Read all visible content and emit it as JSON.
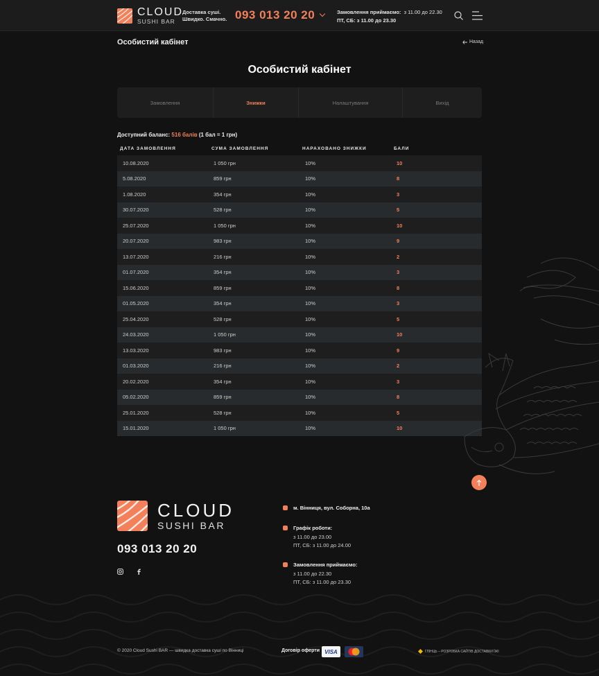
{
  "header": {
    "logo_big": "CLOUD",
    "logo_small": "SUSHI BAR",
    "slogan_line1": "Доставка суші.",
    "slogan_line2": "Швидко. Смачно.",
    "phone": "093 013 20 20",
    "hours_label": "Замовлення приймаємо:",
    "hours_weekday": "з 11.00 до 22.30",
    "hours_weekend": "ПТ, СБ: з 11.00 до 23.30"
  },
  "page": {
    "breadcrumb_title": "Особистий кабінет",
    "back_label": "Назад",
    "title": "Особистий кабінет"
  },
  "tabs": [
    {
      "label": "Замовлення",
      "active": false
    },
    {
      "label": "Знижки",
      "active": true
    },
    {
      "label": "Налаштування",
      "active": false
    },
    {
      "label": "Вихід",
      "active": false
    }
  ],
  "balance": {
    "label": "Доступний баланс:",
    "value": "516 балів",
    "note": "(1 бал = 1 грн)"
  },
  "table": {
    "headers": [
      "ДАТА ЗАМОВЛЕННЯ",
      "СУМА ЗАМОВЛЕННЯ",
      "НАРАХОВАНО ЗНИЖКИ",
      "БАЛИ"
    ],
    "rows": [
      [
        "10.08.2020",
        "1 050 грн",
        "10%",
        "10"
      ],
      [
        "5.08.2020",
        "859 грн",
        "10%",
        "8"
      ],
      [
        "1.08.2020",
        "354 грн",
        "10%",
        "3"
      ],
      [
        "30.07.2020",
        "528 грн",
        "10%",
        "5"
      ],
      [
        "25.07.2020",
        "1 050 грн",
        "10%",
        "10"
      ],
      [
        "20.07.2020",
        "983 грн",
        "10%",
        "9"
      ],
      [
        "13.07.2020",
        "216 грн",
        "10%",
        "2"
      ],
      [
        "01.07.2020",
        "354 грн",
        "10%",
        "3"
      ],
      [
        "15.06.2020",
        "859 грн",
        "10%",
        "8"
      ],
      [
        "01.05.2020",
        "354 грн",
        "10%",
        "3"
      ],
      [
        "25.04.2020",
        "528 грн",
        "10%",
        "5"
      ],
      [
        "24.03.2020",
        "1 050 грн",
        "10%",
        "10"
      ],
      [
        "13.03.2020",
        "983 грн",
        "10%",
        "9"
      ],
      [
        "01.03.2020",
        "216 грн",
        "10%",
        "2"
      ],
      [
        "20.02.2020",
        "354 грн",
        "10%",
        "3"
      ],
      [
        "05.02.2020",
        "859 грн",
        "10%",
        "8"
      ],
      [
        "25.01.2020",
        "528 грн",
        "10%",
        "5"
      ],
      [
        "15.01.2020",
        "1 050 грн",
        "10%",
        "10"
      ]
    ]
  },
  "footer": {
    "logo_big": "CLOUD",
    "logo_small": "SUSHI BAR",
    "phone": "093 013 20 20",
    "address": "м. Вінниця, вул. Соборна, 10а",
    "schedule_title": "Графік роботи:",
    "schedule_weekday": "з 11.00 до 23.00",
    "schedule_weekend": "ПТ, СБ: з 11.00 до 24.00",
    "orders_title": "Замовлення приймаємо:",
    "orders_weekday": "з 11.00 до 22.30",
    "orders_weekend": "ПТ, СБ: з 11.00 до 23.30",
    "copyright": "© 2020 Cloud Sushi BAR  — швидка доставка суші по Вінниці",
    "offer_link": "Договір оферти",
    "visa": "VISA",
    "developer": "ГЛІНЦЬ – РОЗРОБКА САЙТІВ ДОСТАВКИ ЇЖІ"
  },
  "colors": {
    "accent": "#f2805a",
    "background": "#121212",
    "panel": "#1e1e1e",
    "row_alt": "#282b2d"
  }
}
